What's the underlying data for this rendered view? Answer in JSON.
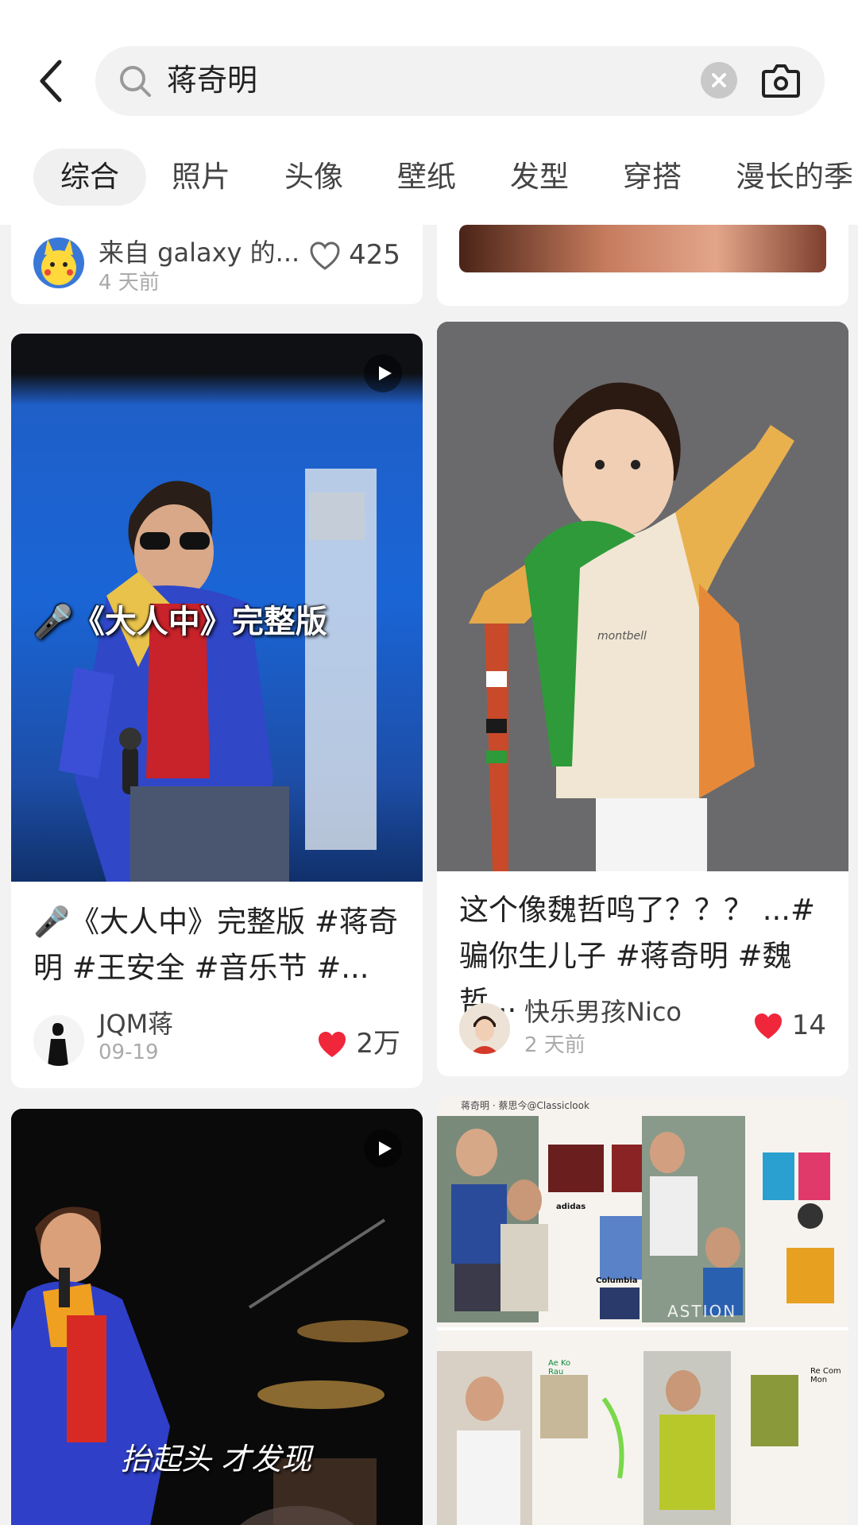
{
  "header": {
    "query": "蒋奇明"
  },
  "tabs": [
    "综合",
    "照片",
    "头像",
    "壁纸",
    "发型",
    "穿搭",
    "漫长的季"
  ],
  "cards": {
    "top_left": {
      "author": "来自 galaxy 的...",
      "date": "4 天前",
      "likes": "425"
    },
    "video1": {
      "overlay": "🎤《大人中》完整版",
      "title": "🎤《大人中》完整版 #蒋奇明 #王安全 #音乐节 #...",
      "author": "JQM蒋",
      "date": "09-19",
      "likes": "2万"
    },
    "kid": {
      "title": "这个像魏哲鸣了？？？ ...#骗你生儿子 #蒋奇明 #魏哲...",
      "author": "快乐男孩Nico",
      "date": "2 天前",
      "likes": "14",
      "shirt_text": "montbell"
    },
    "video2": {
      "overlay": "抬起头 才发现"
    },
    "collage": {
      "header": "蒋奇明 · 蔡思今@Classiclook",
      "brand1": "Columbia",
      "brand2": "adidas",
      "brand3": "Re Com Mon",
      "brand4": "Ae Ko Rau",
      "stamp": "ASTION"
    }
  },
  "colors": {
    "like_red": "#f0263a",
    "stage_blue": "#1e6fd6"
  }
}
